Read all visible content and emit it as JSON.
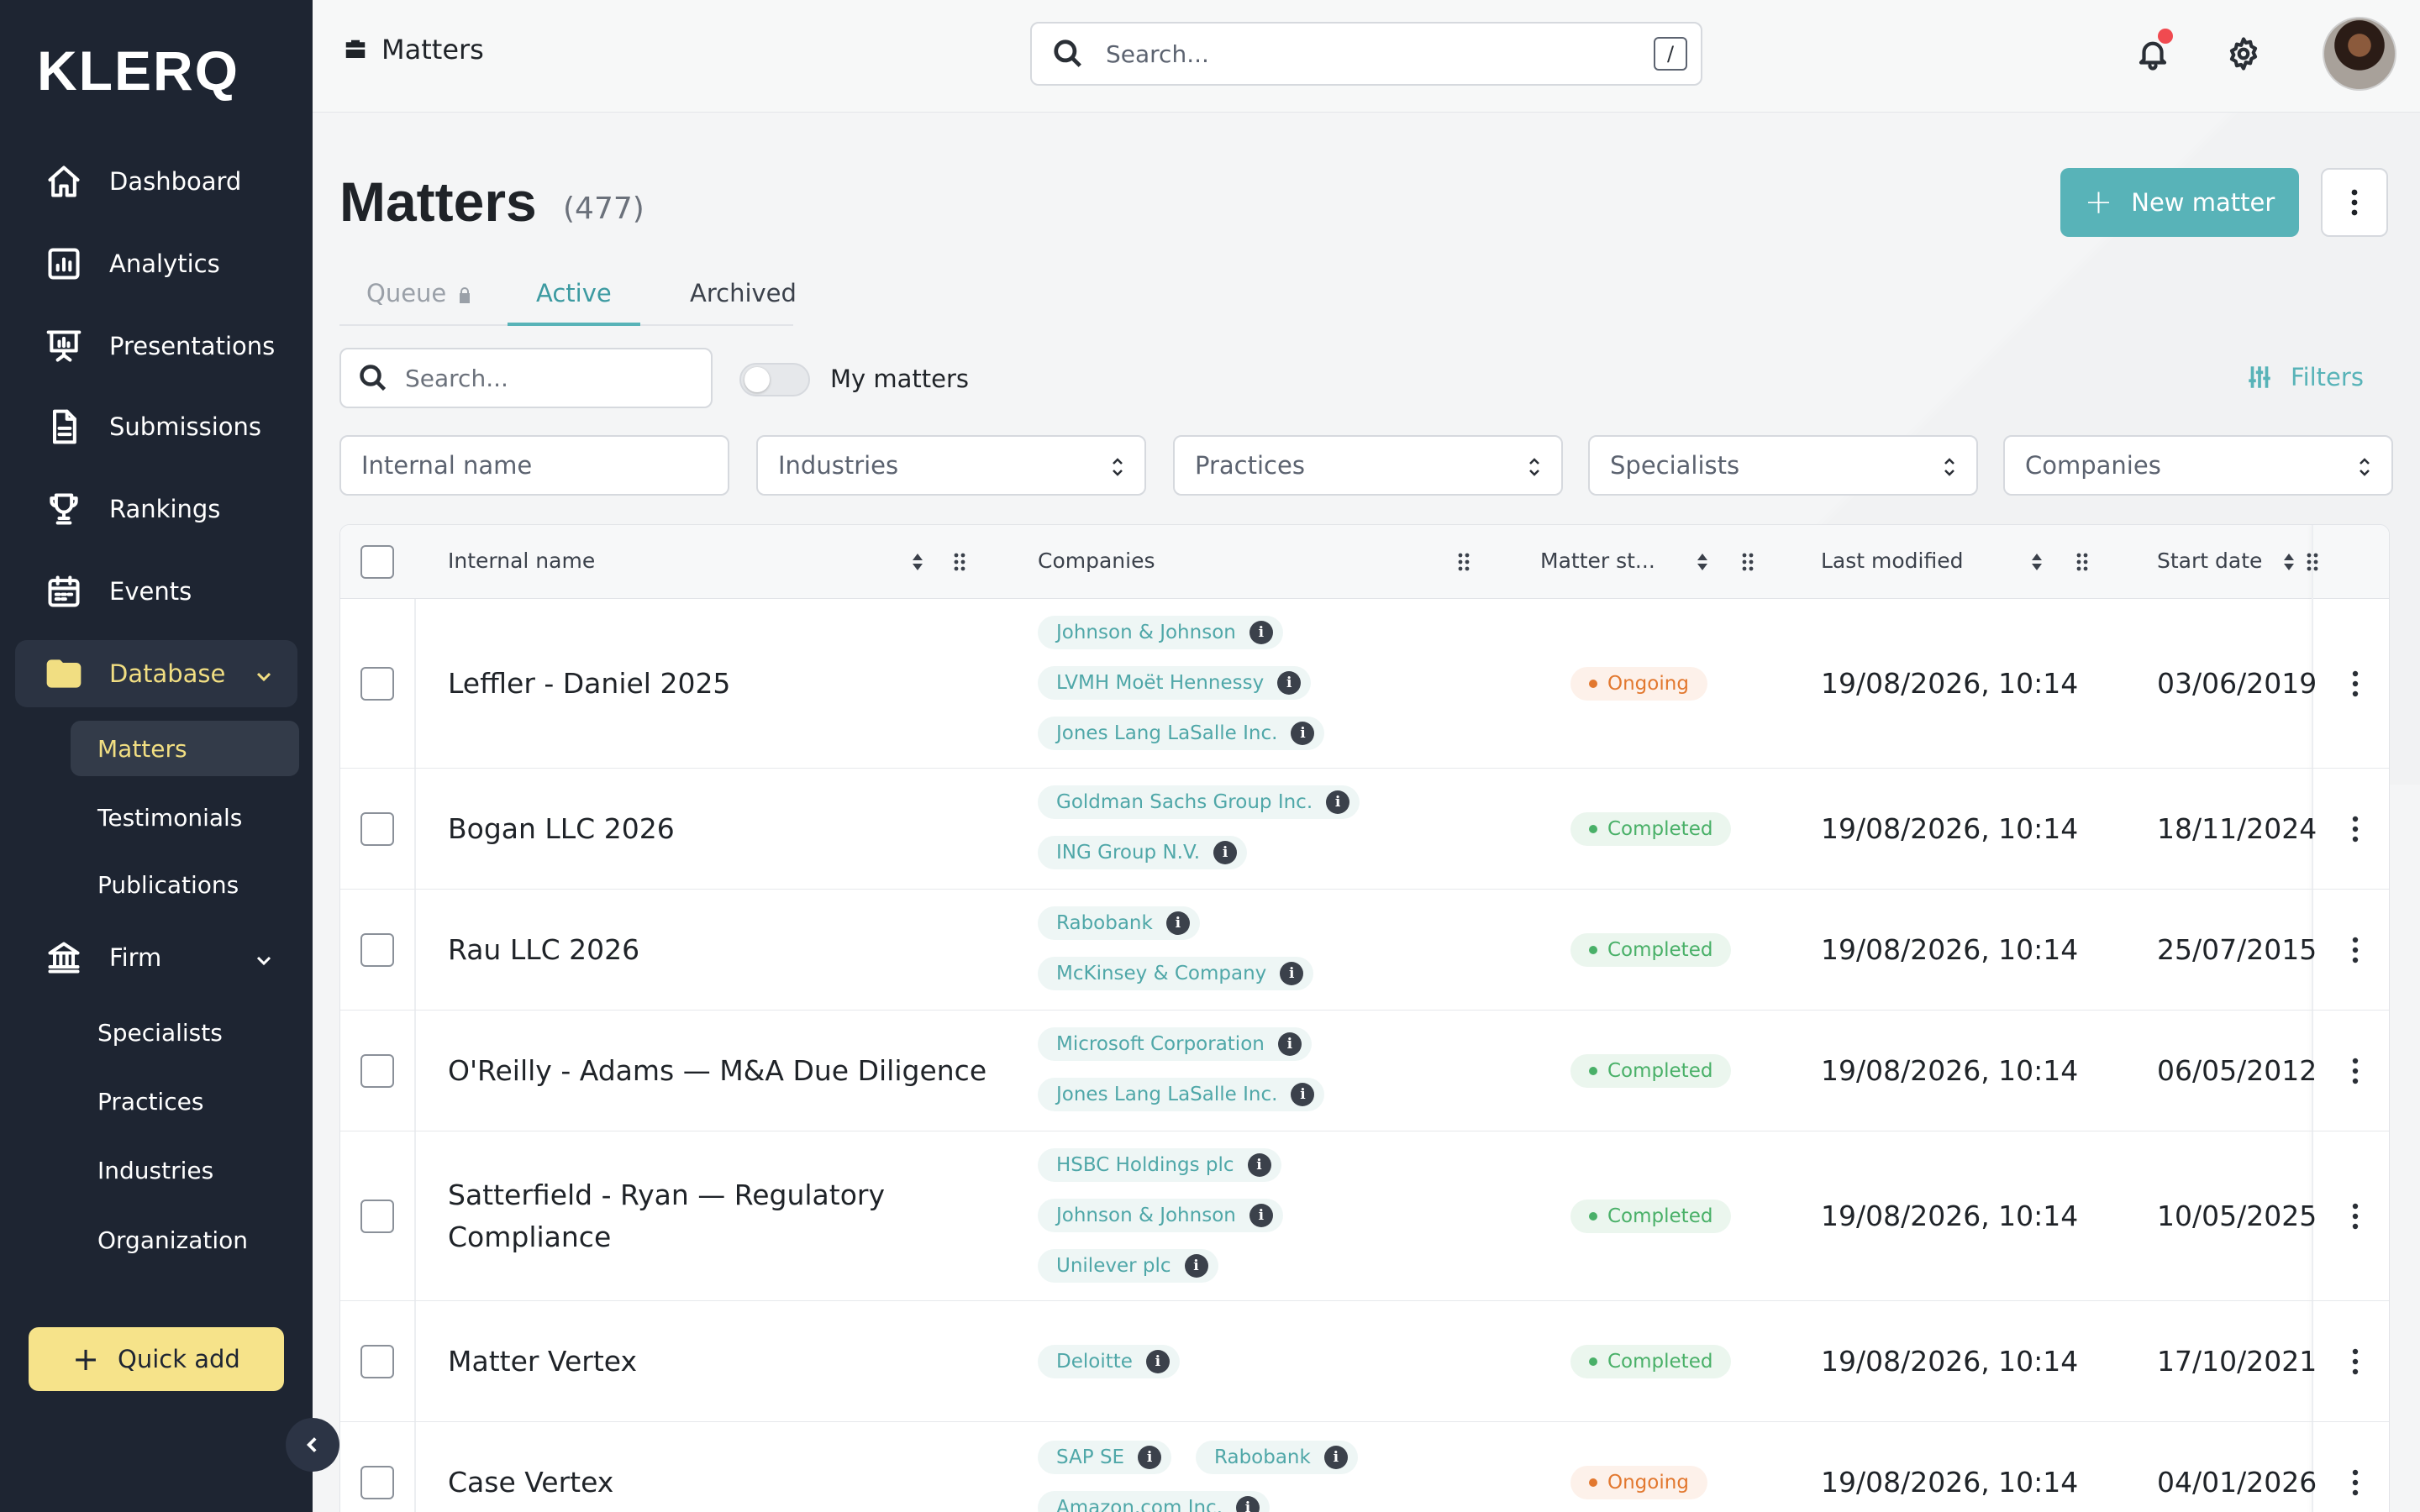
{
  "brand": {
    "logo": "KLERQ"
  },
  "sidebar": {
    "items": [
      {
        "label": "Dashboard",
        "icon": "home-icon"
      },
      {
        "label": "Analytics",
        "icon": "analytics-icon"
      },
      {
        "label": "Presentations",
        "icon": "presentation-icon"
      },
      {
        "label": "Submissions",
        "icon": "document-icon"
      },
      {
        "label": "Rankings",
        "icon": "trophy-icon"
      },
      {
        "label": "Events",
        "icon": "calendar-icon"
      }
    ],
    "database": {
      "label": "Database",
      "children": [
        "Matters",
        "Testimonials",
        "Publications"
      ]
    },
    "firm": {
      "label": "Firm",
      "children": [
        "Specialists",
        "Practices",
        "Industries",
        "Organization"
      ]
    },
    "quick_add": "Quick add"
  },
  "topbar": {
    "breadcrumb": "Matters",
    "search_placeholder": "Search...",
    "search_shortcut": "/"
  },
  "page": {
    "title": "Matters",
    "count": "(477)",
    "new_button": "New matter",
    "tabs": [
      "Queue",
      "Active",
      "Archived"
    ],
    "search_placeholder": "Search...",
    "my_matters": "My matters",
    "filters": "Filters",
    "filter_fields": [
      "Internal name",
      "Industries",
      "Practices",
      "Specialists",
      "Companies"
    ]
  },
  "table": {
    "columns": {
      "name": "Internal name",
      "companies": "Companies",
      "status": "Matter st...",
      "modified": "Last modified",
      "start": "Start date"
    },
    "rows": [
      {
        "name": "Leffler - Daniel 2025",
        "companies": [
          "Johnson & Johnson",
          "LVMH Moët Hennessy",
          "Jones Lang LaSalle Inc."
        ],
        "status": "Ongoing",
        "modified": "19/08/2026, 10:14",
        "start": "03/06/2019"
      },
      {
        "name": "Bogan LLC 2026",
        "companies": [
          "Goldman Sachs Group Inc.",
          "ING Group N.V."
        ],
        "status": "Completed",
        "modified": "19/08/2026, 10:14",
        "start": "18/11/2024"
      },
      {
        "name": "Rau LLC 2026",
        "companies": [
          "Rabobank",
          "McKinsey & Company"
        ],
        "status": "Completed",
        "modified": "19/08/2026, 10:14",
        "start": "25/07/2015"
      },
      {
        "name": "O'Reilly - Adams — M&A Due Diligence",
        "companies": [
          "Microsoft Corporation",
          "Jones Lang LaSalle Inc."
        ],
        "status": "Completed",
        "modified": "19/08/2026, 10:14",
        "start": "06/05/2012"
      },
      {
        "name": "Satterfield - Ryan — Regulatory Compliance",
        "companies": [
          "HSBC Holdings plc",
          "Johnson & Johnson",
          "Unilever plc"
        ],
        "status": "Completed",
        "modified": "19/08/2026, 10:14",
        "start": "10/05/2025"
      },
      {
        "name": "Matter Vertex",
        "companies": [
          "Deloitte"
        ],
        "status": "Completed",
        "modified": "19/08/2026, 10:14",
        "start": "17/10/2021"
      },
      {
        "name": "Case Vertex",
        "companies": [
          "SAP SE",
          "Rabobank",
          "Amazon.com Inc."
        ],
        "status": "Ongoing",
        "modified": "19/08/2026, 10:14",
        "start": "04/01/2026"
      }
    ]
  },
  "colors": {
    "sidebar_bg": "#1e2532",
    "accent_teal": "#58b3b8",
    "active_yellow": "#f1de82",
    "ongoing": "#e2782f",
    "completed": "#49b068"
  }
}
